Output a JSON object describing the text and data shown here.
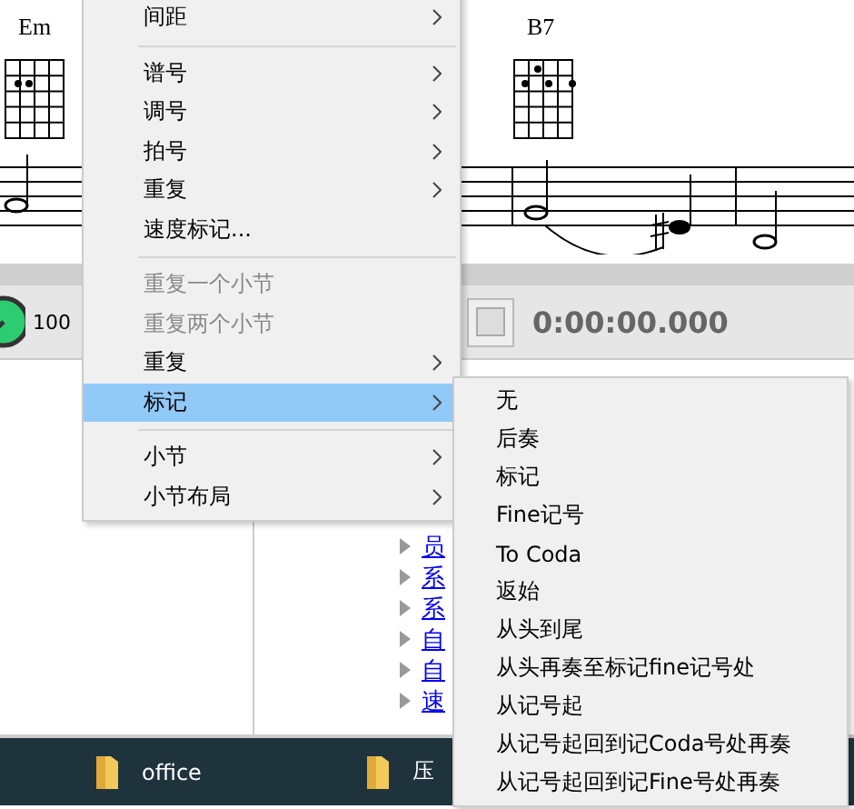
{
  "score": {
    "chords": [
      {
        "name": "Em"
      },
      {
        "name": "B7"
      }
    ]
  },
  "toolbar": {
    "tempo": "100",
    "time": "0:00:00.000"
  },
  "links": [
    "员",
    "系",
    "系",
    "自",
    "自",
    "速"
  ],
  "taskbar": [
    {
      "label": "office"
    },
    {
      "label": "压"
    }
  ],
  "menu": {
    "items": [
      {
        "kind": "item",
        "label": "间距",
        "submenu": true,
        "disabled": false,
        "selected": false
      },
      {
        "kind": "separator"
      },
      {
        "kind": "item",
        "label": "谱号",
        "submenu": true,
        "disabled": false,
        "selected": false
      },
      {
        "kind": "item",
        "label": "调号",
        "submenu": true,
        "disabled": false,
        "selected": false
      },
      {
        "kind": "item",
        "label": "拍号",
        "submenu": true,
        "disabled": false,
        "selected": false
      },
      {
        "kind": "item",
        "label": "重复",
        "submenu": true,
        "disabled": false,
        "selected": false
      },
      {
        "kind": "item",
        "label": "速度标记...",
        "submenu": false,
        "disabled": false,
        "selected": false
      },
      {
        "kind": "separator"
      },
      {
        "kind": "item",
        "label": "重复一个小节",
        "submenu": false,
        "disabled": true,
        "selected": false
      },
      {
        "kind": "item",
        "label": "重复两个小节",
        "submenu": false,
        "disabled": true,
        "selected": false
      },
      {
        "kind": "item",
        "label": "重复",
        "submenu": true,
        "disabled": false,
        "selected": false
      },
      {
        "kind": "item",
        "label": "标记",
        "submenu": true,
        "disabled": false,
        "selected": true
      },
      {
        "kind": "separator"
      },
      {
        "kind": "item",
        "label": "小节",
        "submenu": true,
        "disabled": false,
        "selected": false
      },
      {
        "kind": "item",
        "label": "小节布局",
        "submenu": true,
        "disabled": false,
        "selected": false
      }
    ]
  },
  "submenu": {
    "items": [
      "无",
      "后奏",
      "标记",
      "Fine记号",
      "To Coda",
      "返始",
      "从头到尾",
      "从头再奏至标记fine记号处",
      "从记号起",
      "从记号起回到记Coda号处再奏",
      "从记号起回到记Fine号处再奏"
    ]
  }
}
